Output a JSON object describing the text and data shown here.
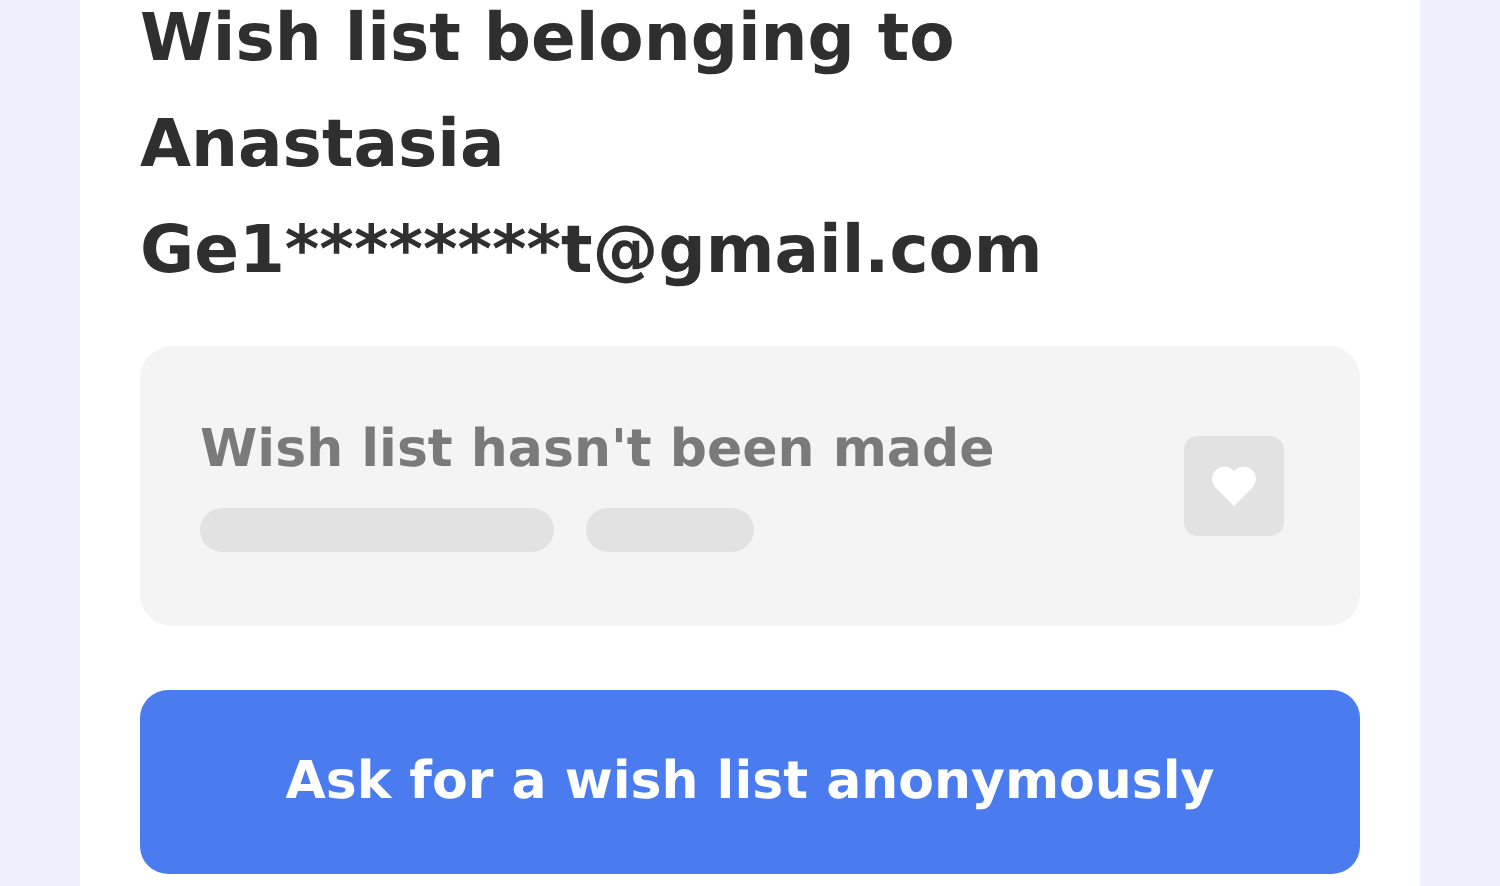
{
  "title": "Wish list belonging to Anastasia Ge1********t@gmail.com",
  "wishlist_status": {
    "message": "Wish list hasn't been made"
  },
  "action_button": {
    "label": "Ask for a wish list anonymously"
  }
}
